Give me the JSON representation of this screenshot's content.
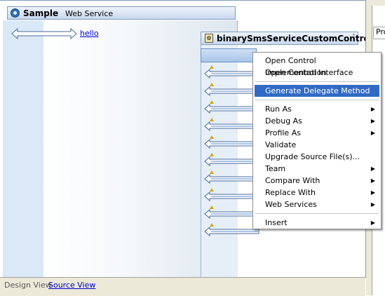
{
  "service": {
    "name": "Sample",
    "type": "Web Service"
  },
  "operation": {
    "label": "hello"
  },
  "control": {
    "name": "binarySmsServiceCustomControl",
    "collapse_icon": "double-chevron-up-icon"
  },
  "method_arrows": {
    "count": 10
  },
  "view_tabs": {
    "design": "Design View",
    "source": "Source View"
  },
  "right_panel": {
    "tab_label": "Pro"
  },
  "context_menu": {
    "items": [
      {
        "label": "Open Control Implementation",
        "submenu": false
      },
      {
        "label": "Open Control Interface",
        "submenu": false
      },
      {
        "separator": true
      },
      {
        "label": "Generate Delegate Method",
        "submenu": false,
        "selected": true
      },
      {
        "separator": true
      },
      {
        "label": "Run As",
        "submenu": true
      },
      {
        "label": "Debug As",
        "submenu": true
      },
      {
        "label": "Profile As",
        "submenu": true
      },
      {
        "label": "Validate",
        "submenu": false
      },
      {
        "label": "Upgrade Source File(s)...",
        "submenu": false
      },
      {
        "label": "Team",
        "submenu": true
      },
      {
        "label": "Compare With",
        "submenu": true
      },
      {
        "label": "Replace With",
        "submenu": true
      },
      {
        "label": "Web Services",
        "submenu": true
      },
      {
        "separator": true
      },
      {
        "label": "Insert",
        "submenu": true
      }
    ]
  },
  "colors": {
    "selection": "#316ac5",
    "link": "#0000cc",
    "lane_blue": "#dbe8f8"
  }
}
